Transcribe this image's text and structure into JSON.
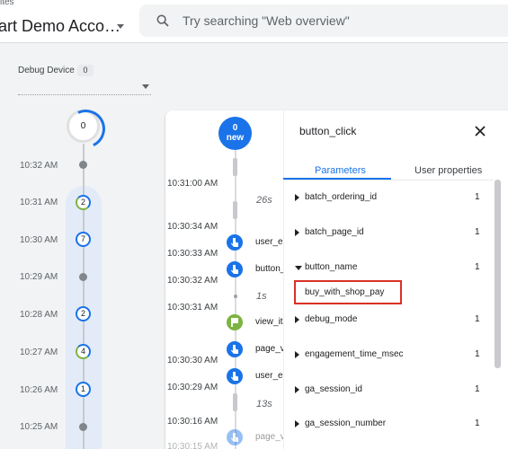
{
  "header": {
    "breadcrumb": "ites",
    "account": "art Demo Acco…",
    "search_placeholder": "Try searching \"Web overview\""
  },
  "debug_device": {
    "label": "Debug Device",
    "count": "0"
  },
  "minutes": {
    "top_count": "0",
    "rows": [
      {
        "time": "10:32 AM",
        "count": ""
      },
      {
        "time": "10:31 AM",
        "count": "2"
      },
      {
        "time": "10:30 AM",
        "count": "7"
      },
      {
        "time": "10:29 AM",
        "count": ""
      },
      {
        "time": "10:28 AM",
        "count": "2"
      },
      {
        "time": "10:27 AM",
        "count": "4"
      },
      {
        "time": "10:26 AM",
        "count": "1"
      },
      {
        "time": "10:25 AM",
        "count": ""
      }
    ]
  },
  "stream": {
    "new_count": "0",
    "new_label": "new",
    "timestamps": [
      "10:31:00 AM",
      "10:30:34 AM",
      "10:30:33 AM",
      "10:30:32 AM",
      "10:30:31 AM",
      "10:30:30 AM",
      "10:30:29 AM",
      "10:30:16 AM",
      "10:30:15 AM"
    ],
    "gaps": [
      "26s",
      "1s",
      "13s"
    ],
    "events": [
      "user_en",
      "button_",
      "view_ite",
      "page_v",
      "user_en",
      "page_v"
    ]
  },
  "panel": {
    "title": "button_click",
    "tabs": [
      "Parameters",
      "User properties"
    ],
    "params": [
      {
        "name": "batch_ordering_id",
        "count": "1"
      },
      {
        "name": "batch_page_id",
        "count": "1"
      },
      {
        "name": "button_name",
        "count": "1"
      },
      {
        "name": "debug_mode",
        "count": "1"
      },
      {
        "name": "engagement_time_msec",
        "count": "1"
      },
      {
        "name": "ga_session_id",
        "count": "1"
      },
      {
        "name": "ga_session_number",
        "count": "1"
      }
    ],
    "expanded_value": "buy_with_shop_pay"
  },
  "colors": {
    "accent": "#1a73e8",
    "highlight": "#d93025",
    "flag": "#7cb342"
  }
}
